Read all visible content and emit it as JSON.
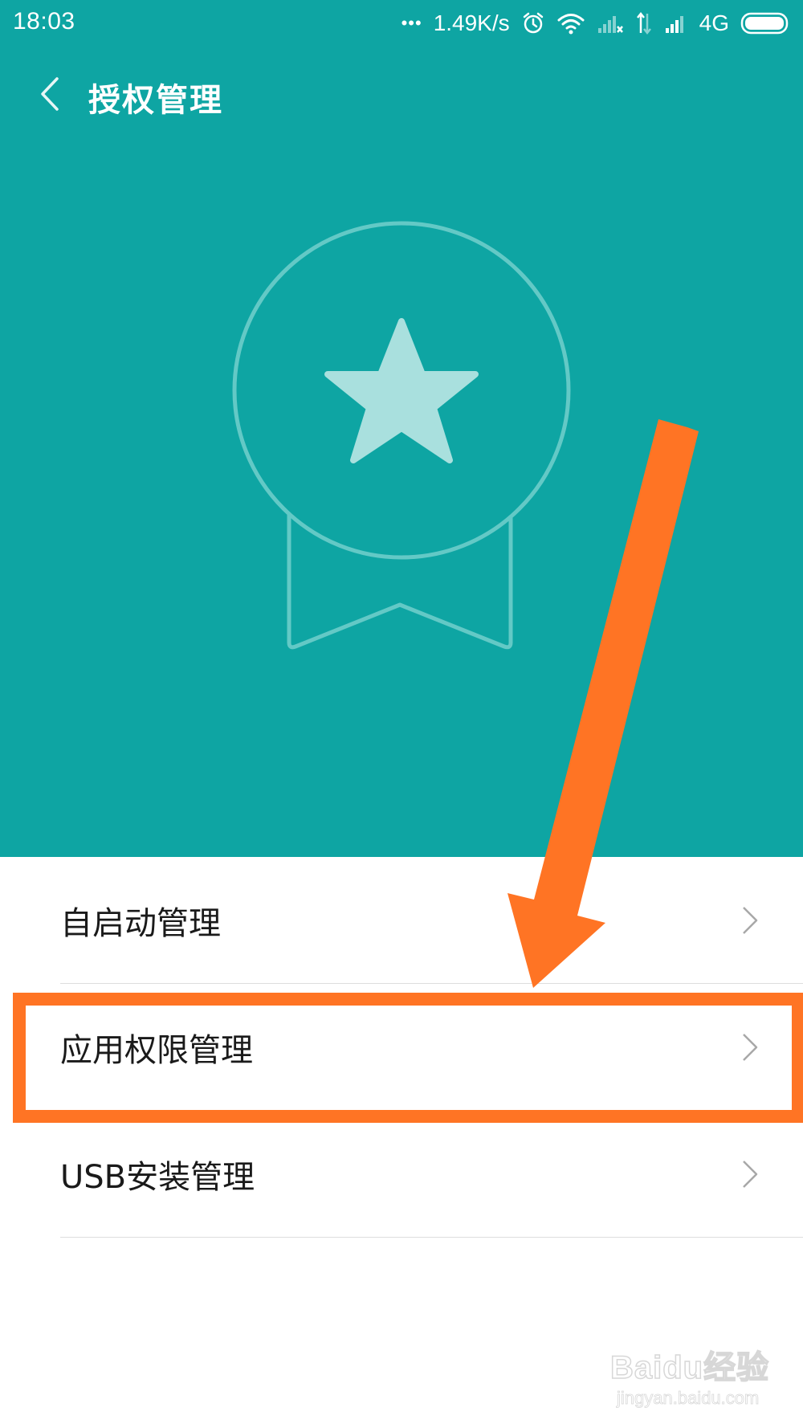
{
  "status_bar": {
    "time": "18:03",
    "dots": "•••",
    "net_speed": "1.49K/s",
    "network_type": "4G",
    "icons": [
      "more-dots-icon",
      "alarm-icon",
      "wifi-icon",
      "signal-no-sim-icon",
      "data-transfer-icon",
      "signal-icon",
      "battery-icon"
    ]
  },
  "header": {
    "title": "授权管理",
    "background_color": "#0ea5a3",
    "illustration": "award-badge-icon"
  },
  "list": {
    "items": [
      {
        "label": "自启动管理",
        "icon": "chevron-right-icon"
      },
      {
        "label": "应用权限管理",
        "icon": "chevron-right-icon"
      },
      {
        "label": "USB安装管理",
        "icon": "chevron-right-icon"
      }
    ]
  },
  "annotation": {
    "color": "#ff7424",
    "highlighted_item": "应用权限管理"
  },
  "watermark": {
    "logo": "Baidu经验",
    "url": "jingyan.baidu.com"
  }
}
